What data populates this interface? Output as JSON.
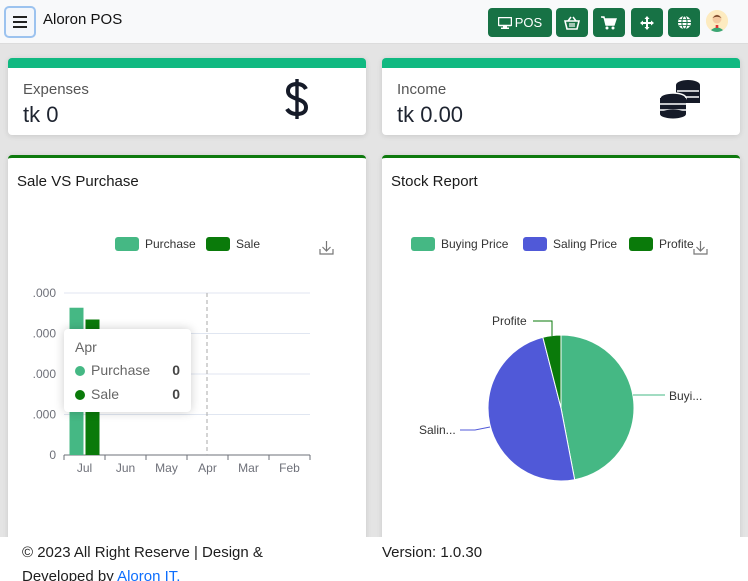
{
  "header": {
    "app_title": "Aloron POS",
    "pos_label": "POS",
    "icons": [
      "menu-icon",
      "monitor-icon",
      "basket-icon",
      "cart-icon",
      "move-icon",
      "globe-icon",
      "avatar-icon"
    ]
  },
  "stats": {
    "expenses": {
      "label": "Expenses",
      "value": "tk 0",
      "icon": "dollar-icon"
    },
    "income": {
      "label": "Income",
      "value": "tk 0.00",
      "icon": "coins-icon"
    }
  },
  "sale_vs_purchase": {
    "title": "Sale VS Purchase",
    "tooltip": {
      "title": "Apr",
      "rows": [
        {
          "name": "Purchase",
          "value": "0"
        },
        {
          "name": "Sale",
          "value": "0"
        }
      ]
    }
  },
  "stock_report": {
    "title": "Stock Report",
    "labels": {
      "profite": "Profite",
      "saling": "Salin...",
      "buying": "Buyi..."
    }
  },
  "chart_data": [
    {
      "type": "bar",
      "categories": [
        "Jul",
        "Jun",
        "May",
        "Apr",
        "Mar",
        "Feb"
      ],
      "y_tick_labels": [
        ".000",
        ".000",
        ".000",
        ".000",
        "0"
      ],
      "series": [
        {
          "name": "Purchase",
          "color": "#45b884",
          "values": [
            1.0,
            0,
            0,
            0,
            0,
            0
          ]
        },
        {
          "name": "Sale",
          "color": "#0a7a0a",
          "values": [
            0.92,
            0,
            0,
            0,
            0,
            0
          ]
        }
      ],
      "ylim": [
        0,
        1.1
      ],
      "legend": "top",
      "grid": true
    },
    {
      "type": "pie",
      "legend": "top",
      "series": [
        {
          "name": "Buying Price",
          "color": "#45b884",
          "value": 47
        },
        {
          "name": "Saling Price",
          "color": "#5059d8",
          "value": 49
        },
        {
          "name": "Profite",
          "color": "#0a7a0a",
          "value": 4
        }
      ]
    }
  ],
  "footer": {
    "copyright": "© 2023 All Right Reserve | Design & Developed by",
    "link": "Aloron IT.",
    "version": "Version: 1.0.30"
  },
  "colors": {
    "brand": "#177245",
    "card_accent": "#10b981",
    "chart_border": "#0e7a0e",
    "link": "#0d6efd"
  }
}
